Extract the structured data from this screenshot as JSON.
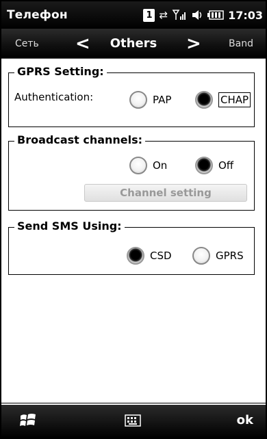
{
  "status": {
    "title": "Телефон",
    "sim": "1",
    "time": "17:03"
  },
  "tabs": {
    "left": "Сеть",
    "current": "Others",
    "right": "Band"
  },
  "gprs": {
    "title": "GPRS Setting:",
    "auth_label": "Authentication:",
    "options": [
      "PAP",
      "CHAP"
    ],
    "selected": "CHAP"
  },
  "broadcast": {
    "title": "Broadcast channels:",
    "options": [
      "On",
      "Off"
    ],
    "selected": "Off",
    "channel_button": "Channel setting"
  },
  "sms": {
    "title": "Send SMS Using:",
    "options": [
      "CSD",
      "GPRS"
    ],
    "selected": "CSD"
  },
  "bottom": {
    "ok": "ok"
  }
}
